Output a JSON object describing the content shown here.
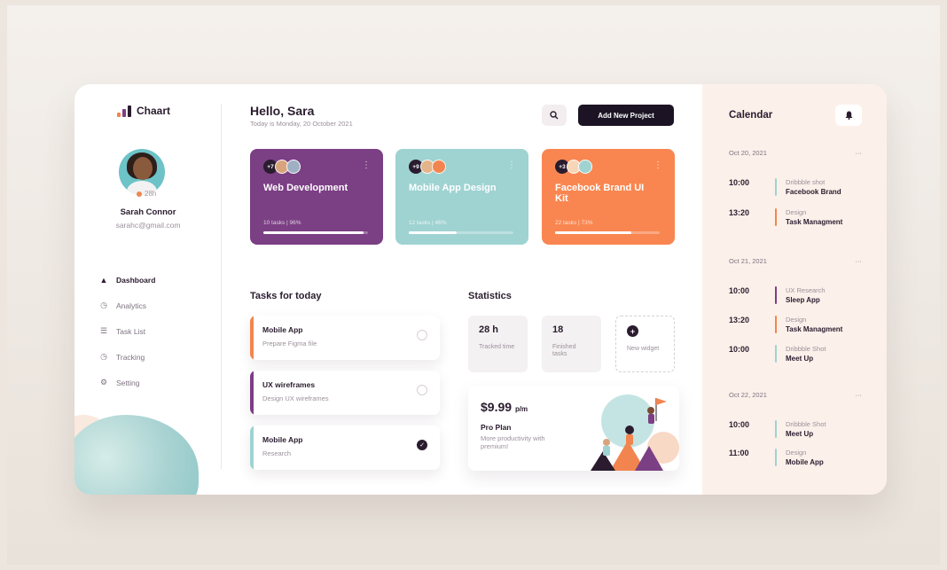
{
  "brand": {
    "name": "Chaart",
    "bar_colors": [
      "#f2854f",
      "#7b3f84",
      "#2a1c2e"
    ]
  },
  "user": {
    "name": "Sarah Connor",
    "email": "sarahc@gmail.com",
    "age": "28h"
  },
  "nav": [
    {
      "label": "Dashboard",
      "icon": "home-icon",
      "active": true
    },
    {
      "label": "Analytics",
      "icon": "analytics-icon"
    },
    {
      "label": "Task List",
      "icon": "task-list-icon"
    },
    {
      "label": "Tracking",
      "icon": "tracking-icon"
    },
    {
      "label": "Setting",
      "icon": "gear-icon"
    }
  ],
  "header": {
    "greeting": "Hello, Sara",
    "date_text": "Today is Monday, 20 October 2021",
    "search_icon": "search-icon",
    "add_label": "Add New Project"
  },
  "projects": [
    {
      "title": "Web Development",
      "count": "+7",
      "meta": "10 tasks | 96%",
      "progress": 0.96,
      "color": "#7b3f84",
      "bar_fill": "#ffffff"
    },
    {
      "title": "Mobile App Design",
      "count": "+9",
      "meta": "12 tasks | 46%",
      "progress": 0.46,
      "color": "#9fd3d2",
      "bar_fill": "#ffffff"
    },
    {
      "title": "Facebook Brand UI Kit",
      "count": "+3",
      "meta": "22 tasks | 73%",
      "progress": 0.73,
      "color": "#f98650",
      "bar_fill": "#ffffff"
    }
  ],
  "tasks_section": {
    "title": "Tasks for today",
    "items": [
      {
        "title": "Mobile App",
        "subtitle": "Prepare Figma file",
        "done": false,
        "color": "#f2854f"
      },
      {
        "title": "UX wireframes",
        "subtitle": "Design UX wireframes",
        "done": false,
        "color": "#7b3f84"
      },
      {
        "title": "Mobile App",
        "subtitle": "Research",
        "done": true,
        "color": "#9fd3d2"
      }
    ]
  },
  "statistics": {
    "title": "Statistics",
    "tracked": {
      "value": "28 h",
      "label": "Tracked time"
    },
    "finished": {
      "value": "18",
      "label": "Finished tasks"
    },
    "widget": {
      "label": "New widget"
    }
  },
  "pro_plan": {
    "price": "$9.99",
    "period": "p/m",
    "name": "Pro Plan",
    "desc": "More productivity with premium!"
  },
  "calendar": {
    "title": "Calendar",
    "days": [
      {
        "date": "Oct 20, 2021",
        "events": [
          {
            "time": "10:00",
            "type": "Dribbble shot",
            "name": "Facebook Brand",
            "color": "#9fd3d2"
          },
          {
            "time": "13:20",
            "type": "Design",
            "name": "Task Managment",
            "color": "#f2854f"
          }
        ]
      },
      {
        "date": "Oct 21, 2021",
        "events": [
          {
            "time": "10:00",
            "type": "UX Research",
            "name": "Sleep App",
            "color": "#7b3f84"
          },
          {
            "time": "13:20",
            "type": "Design",
            "name": "Task Managment",
            "color": "#f2854f"
          },
          {
            "time": "10:00",
            "type": "Dribbble Shot",
            "name": "Meet Up",
            "color": "#9fd3d2"
          }
        ]
      },
      {
        "date": "Oct 22, 2021",
        "events": [
          {
            "time": "10:00",
            "type": "Dribbble Shot",
            "name": "Meet Up",
            "color": "#9fd3d2"
          },
          {
            "time": "11:00",
            "type": "Design",
            "name": "Mobile App",
            "color": "#9fd3d2"
          }
        ]
      }
    ]
  }
}
